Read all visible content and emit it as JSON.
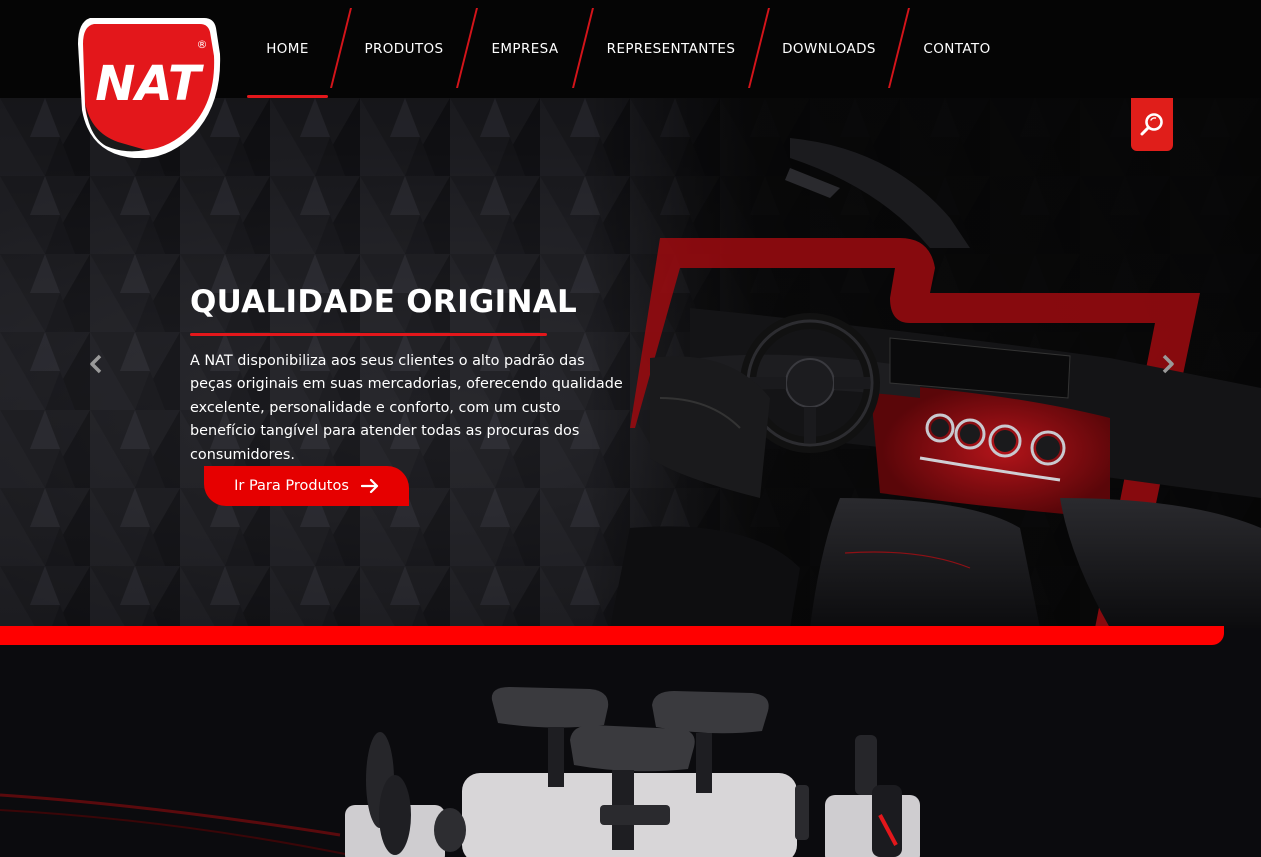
{
  "brand": {
    "logo_text": "NAT",
    "registered_mark": "®",
    "colors": {
      "primary_red": "#e3171b",
      "bright_red": "#ff0000",
      "dark": "#050505"
    }
  },
  "nav": {
    "items": [
      {
        "label": "HOME",
        "active": true
      },
      {
        "label": "PRODUTOS",
        "active": false
      },
      {
        "label": "EMPRESA",
        "active": false
      },
      {
        "label": "REPRESENTANTES",
        "active": false
      },
      {
        "label": "DOWNLOADS",
        "active": false
      },
      {
        "label": "CONTATO",
        "active": false
      }
    ],
    "search_icon": "search-icon"
  },
  "hero": {
    "title": "QUALIDADE ORIGINAL",
    "text": "A NAT disponibiliza aos seus clientes o alto padrão das peças originais em suas mercadorias, oferecendo qualidade excelente, personalidade e conforto, com um custo benefício tangível para atender todas as procuras dos consumidores.",
    "cta_label": "Ir Para Produtos",
    "cta_icon": "arrow-right-icon",
    "prev_icon": "chevron-left-icon",
    "next_icon": "chevron-right-icon"
  }
}
